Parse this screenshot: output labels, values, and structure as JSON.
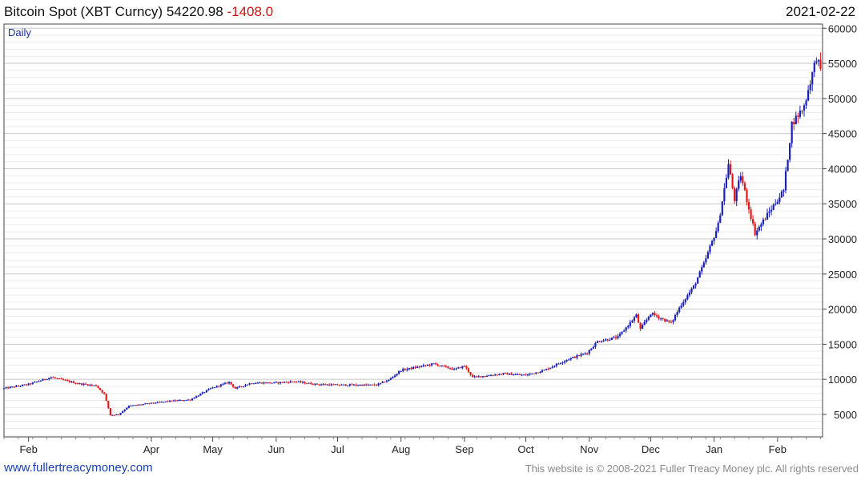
{
  "header": {
    "title_prefix": "Bitcoin Spot (XBT Curncy) 54220.98",
    "change": "-1408.0",
    "date": "2021-02-22"
  },
  "period": "Daily",
  "footer": {
    "link": "www.fullertreacymoney.com",
    "copyright": "This website is © 2008-2021 Fuller Treacy Money plc. All rights reserved"
  },
  "colors": {
    "up": "#1a1fb8",
    "down": "#e01818",
    "grid_major": "#c8c8c8",
    "grid_minor": "#ececec"
  },
  "chart_data": {
    "type": "candlestick",
    "title": "Bitcoin Spot (XBT Curncy)",
    "period": "Daily",
    "last": 54220.98,
    "change": -1408.0,
    "x_range": [
      "2020-01-20",
      "2021-02-23"
    ],
    "ylim": [
      1800,
      60600
    ],
    "y_ticks": [
      5000,
      10000,
      15000,
      20000,
      25000,
      30000,
      35000,
      40000,
      45000,
      50000,
      55000,
      60000
    ],
    "y_tick_labels": [
      "5000",
      "10000",
      "15000",
      "20000",
      "25000",
      "30000",
      "35000",
      "40000",
      "45000",
      "50000",
      "55000",
      "60000"
    ],
    "x_ticks": [
      {
        "label": "Feb",
        "date": "2020-02-01"
      },
      {
        "label": "Apr",
        "date": "2020-04-01"
      },
      {
        "label": "May",
        "date": "2020-05-01"
      },
      {
        "label": "Jun",
        "date": "2020-06-01"
      },
      {
        "label": "Jul",
        "date": "2020-07-01"
      },
      {
        "label": "Aug",
        "date": "2020-08-01"
      },
      {
        "label": "Sep",
        "date": "2020-09-01"
      },
      {
        "label": "Oct",
        "date": "2020-10-01"
      },
      {
        "label": "Nov",
        "date": "2020-11-01"
      },
      {
        "label": "Dec",
        "date": "2020-12-01"
      },
      {
        "label": "Jan",
        "date": "2021-01-01"
      },
      {
        "label": "Feb",
        "date": "2021-02-01"
      }
    ],
    "price_path": [
      [
        "2020-01-20",
        8700
      ],
      [
        "2020-02-01",
        9300
      ],
      [
        "2020-02-12",
        10300
      ],
      [
        "2020-02-25",
        9400
      ],
      [
        "2020-03-05",
        9100
      ],
      [
        "2020-03-09",
        7900
      ],
      [
        "2020-03-12",
        4900
      ],
      [
        "2020-03-16",
        5000
      ],
      [
        "2020-03-21",
        6200
      ],
      [
        "2020-04-01",
        6600
      ],
      [
        "2020-04-10",
        6900
      ],
      [
        "2020-04-20",
        7100
      ],
      [
        "2020-04-30",
        8700
      ],
      [
        "2020-05-09",
        9600
      ],
      [
        "2020-05-12",
        8700
      ],
      [
        "2020-05-20",
        9500
      ],
      [
        "2020-06-01",
        9500
      ],
      [
        "2020-06-10",
        9700
      ],
      [
        "2020-06-20",
        9300
      ],
      [
        "2020-07-01",
        9200
      ],
      [
        "2020-07-20",
        9200
      ],
      [
        "2020-07-26",
        9900
      ],
      [
        "2020-08-01",
        11300
      ],
      [
        "2020-08-17",
        12200
      ],
      [
        "2020-08-27",
        11400
      ],
      [
        "2020-09-01",
        11900
      ],
      [
        "2020-09-05",
        10300
      ],
      [
        "2020-09-20",
        10800
      ],
      [
        "2020-10-01",
        10600
      ],
      [
        "2020-10-10",
        11300
      ],
      [
        "2020-10-21",
        12800
      ],
      [
        "2020-10-31",
        13800
      ],
      [
        "2020-11-05",
        15400
      ],
      [
        "2020-11-15",
        16000
      ],
      [
        "2020-11-24",
        19100
      ],
      [
        "2020-11-26",
        17100
      ],
      [
        "2020-12-01",
        19400
      ],
      [
        "2020-12-11",
        18000
      ],
      [
        "2020-12-16",
        20700
      ],
      [
        "2020-12-22",
        23200
      ],
      [
        "2020-12-27",
        26400
      ],
      [
        "2021-01-03",
        32000
      ],
      [
        "2021-01-08",
        40600
      ],
      [
        "2021-01-11",
        35600
      ],
      [
        "2021-01-14",
        39100
      ],
      [
        "2021-01-21",
        30800
      ],
      [
        "2021-01-29",
        34300
      ],
      [
        "2021-02-04",
        36900
      ],
      [
        "2021-02-08",
        46400
      ],
      [
        "2021-02-14",
        48900
      ],
      [
        "2021-02-20",
        55900
      ],
      [
        "2021-02-22",
        54221
      ]
    ]
  }
}
